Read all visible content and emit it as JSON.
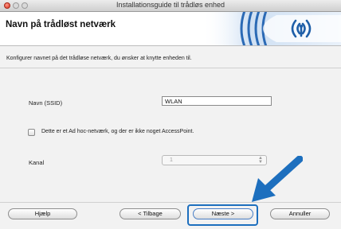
{
  "window": {
    "title": "Installationsguide til trådløs enhed"
  },
  "header": {
    "title": "Navn på trådløst netværk"
  },
  "main": {
    "instruction": "Konfigurer navnet på det trådløse netværk, du ønsker at knytte enheden til.",
    "ssid_label": "Navn (SSID)",
    "ssid_value": "WLAN",
    "adhoc_label": "Dette er et Ad hoc-netværk, og der er ikke noget AccessPoint.",
    "adhoc_checked": false,
    "channel_label": "Kanal",
    "channel_value": "1"
  },
  "footer": {
    "help_label": "Hjælp",
    "back_label": "< Tilbage",
    "next_label": "Næste >",
    "cancel_label": "Annuller"
  },
  "colors": {
    "accent": "#1d6fbe",
    "brand_blue": "#1f5fa8"
  },
  "icons": {
    "header_logo": "wireless-signal-icon",
    "pointer": "arrow-pointer-icon"
  }
}
